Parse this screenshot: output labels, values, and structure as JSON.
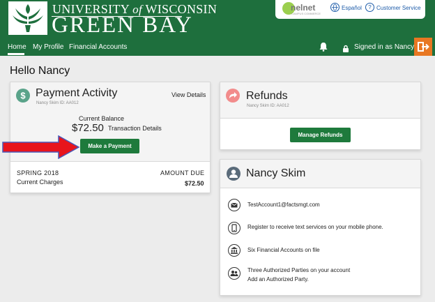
{
  "header": {
    "university_line1_prefix": "UNIVERSITY",
    "university_line1_of": "of",
    "university_line1_suffix": "WISCONSIN",
    "university_line2": "GREEN BAY",
    "brand_color": "#1e6f3d",
    "partner_logo": "nelnet",
    "partner_tagline": "CAMPUS COMMERCE",
    "espanol": "Español",
    "customer_service": "Customer Service"
  },
  "nav": {
    "home": "Home",
    "my_profile": "My Profile",
    "financial_accounts": "Financial Accounts",
    "signed_in": "Signed in as Nancy",
    "logout_color": "#e87722"
  },
  "greeting": "Hello Nancy",
  "payment_activity": {
    "title": "Payment Activity",
    "skim_id": "Nancy Skim ID: AA012",
    "view_details": "View Details",
    "current_balance_label": "Current Balance",
    "current_balance": "$72.50",
    "transaction_details": "Transaction Details",
    "make_payment": "Make a Payment",
    "term": "SPRING 2018",
    "charges_label": "Current Charges",
    "amount_due_label": "AMOUNT DUE",
    "amount_due": "$72.50"
  },
  "refunds": {
    "title": "Refunds",
    "skim_id": "Nancy Skim ID: AA012",
    "manage_refunds": "Manage Refunds"
  },
  "profile": {
    "name": "Nancy Skim",
    "email": "TestAccount1@factsmgt.com",
    "text_services": "Register to receive text services on your mobile phone.",
    "accounts": "Six Financial Accounts on file",
    "parties": "Three Authorized Parties on your account",
    "add_party": "Add an Authorized Party."
  },
  "colors": {
    "button_green": "#1e7a3c",
    "payment_icon": "#5aa38a",
    "refunds_icon": "#f28c8c",
    "profile_icon": "#5a6b7a",
    "arrow_red": "#e8141c"
  }
}
